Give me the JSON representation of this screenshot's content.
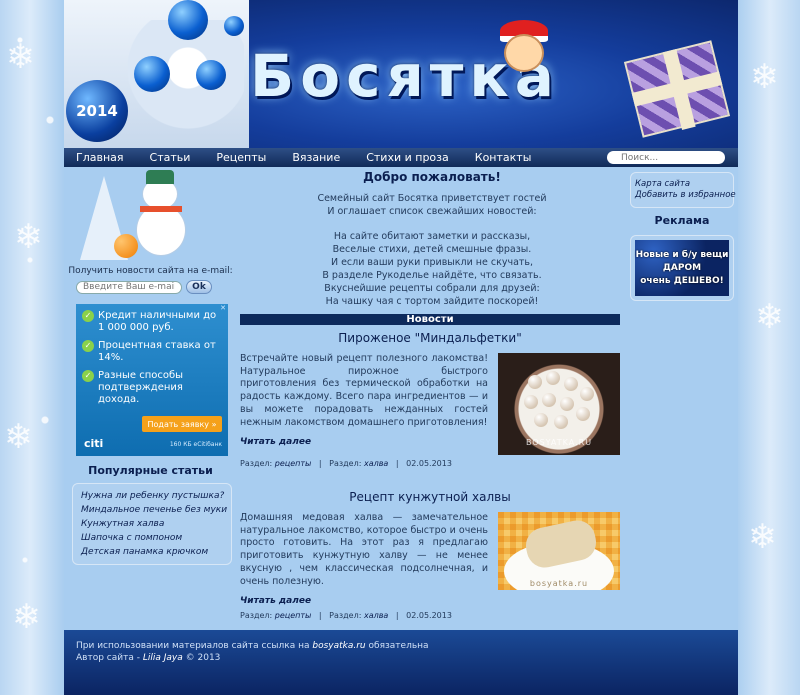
{
  "header": {
    "year": "2014",
    "logo_letters": [
      "Б",
      "о",
      "с",
      "я",
      "т",
      "к",
      "а"
    ]
  },
  "nav": {
    "items": [
      "Главная",
      "Статьи",
      "Рецепты",
      "Вязание",
      "Стихи и проза",
      "Контакты"
    ],
    "search_placeholder": "Поиск..."
  },
  "left": {
    "subscribe_label": "Получить новости сайта на e-mail:",
    "email_placeholder": "Введите Ваш e-mail",
    "ok_label": "Ok",
    "ad": {
      "items": [
        "Кредит наличными до 1 000 000 руб.",
        "Процентная ставка от 14%.",
        "Разные способы подтверждения дохода."
      ],
      "cta": "Подать заявку »",
      "brand": "citi",
      "fine": "160 КБ eСitiбанк"
    },
    "popular_title": "Популярные статьи",
    "popular_items": [
      "Нужна ли ребенку пустышка?",
      "Миндальное печенье без муки",
      "Кунжутная халва",
      "Шапочка с помпоном",
      "Детская панамка крючком"
    ]
  },
  "main": {
    "welcome_title": "Добро пожаловать!",
    "welcome_lines_1": [
      "Семейный сайт Босятка приветствует гостей",
      "И оглашает список свежайших новостей:"
    ],
    "welcome_lines_2": [
      "На сайте обитают заметки и рассказы,",
      "Веселые стихи, детей смешные фразы.",
      "И если ваши руки привыкли не скучать,",
      "В разделе Рукоделье найдёте, что связать.",
      "Вкуснейшие рецепты собрали для друзей:",
      "На чашку чая с тортом зайдите поскорей!"
    ],
    "news_label": "Новости",
    "articles": [
      {
        "title": "Пироженое \"Миндальфетки\"",
        "text": "Встречайте новый рецепт полезного лакомства! Натуральное пирожное быстрого приготовления без термической обработки на радость каждому. Всего пара ингредиентов — и вы можете порадовать нежданных гостей нежным лакомством домашнего приготовления!",
        "read_more": "Читать далее",
        "section_label": "Раздел:",
        "section": "рецепты",
        "subsection_label": "Раздел:",
        "subsection": "халва",
        "date": "02.05.2013",
        "watermark": "BOSYATKA.RU"
      },
      {
        "title": "Рецепт кунжутной халвы",
        "text": "Домашняя медовая халва — замечательное натуральное лакомство, которое быстро и очень просто готовить. На этот раз я предлагаю приготовить кунжутную халву — не менее вкусную , чем классическая подсолнечная, и очень полезную.",
        "read_more": "Читать далее",
        "section_label": "Раздел:",
        "section": "рецепты",
        "subsection_label": "Раздел:",
        "subsection": "халва",
        "date": "02.05.2013",
        "watermark": "bosyatka.ru"
      }
    ]
  },
  "right": {
    "links": [
      "Карта сайта",
      "Добавить в избранное"
    ],
    "ad_title": "Реклама",
    "promo_lines": [
      "Новые и б/у вещи",
      "ДАРОМ",
      "очень ДЕШЕВО!"
    ]
  },
  "footer": {
    "line1_prefix": "При использовании материалов сайта ссылка на",
    "line1_site": "bosyatka.ru",
    "line1_suffix": "обязательна",
    "line2_prefix": "Автор сайта -",
    "line2_author": "Lilia Jaya",
    "line2_suffix": "© 2013"
  }
}
